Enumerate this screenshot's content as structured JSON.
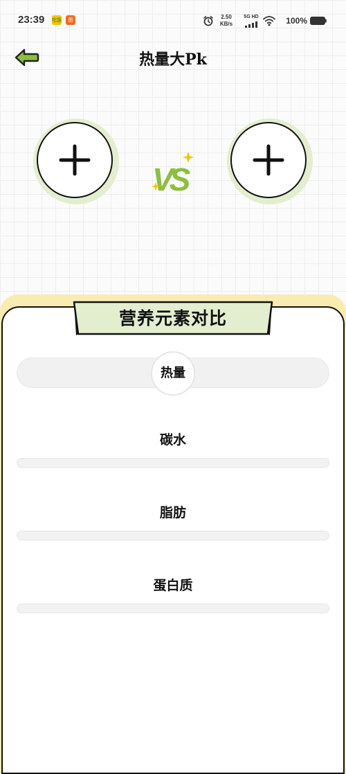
{
  "status_bar": {
    "time": "23:39",
    "app_badge_a": "吃饭",
    "app_badge_b": "团",
    "net_speed_value": "2.50",
    "net_speed_unit": "KB/s",
    "net_type": "5G HD",
    "battery": "100%"
  },
  "header": {
    "title": "热量大Pk"
  },
  "compare": {
    "vs_label": "VS"
  },
  "panel": {
    "title": "营养元素对比",
    "calories_label": "热量",
    "metrics": [
      {
        "label": "碳水"
      },
      {
        "label": "脂肪"
      },
      {
        "label": "蛋白质"
      }
    ]
  },
  "colors": {
    "accent_green": "#8cbf3f",
    "light_green": "#e3eecf",
    "panel_yellow": "#f9ecb0"
  }
}
